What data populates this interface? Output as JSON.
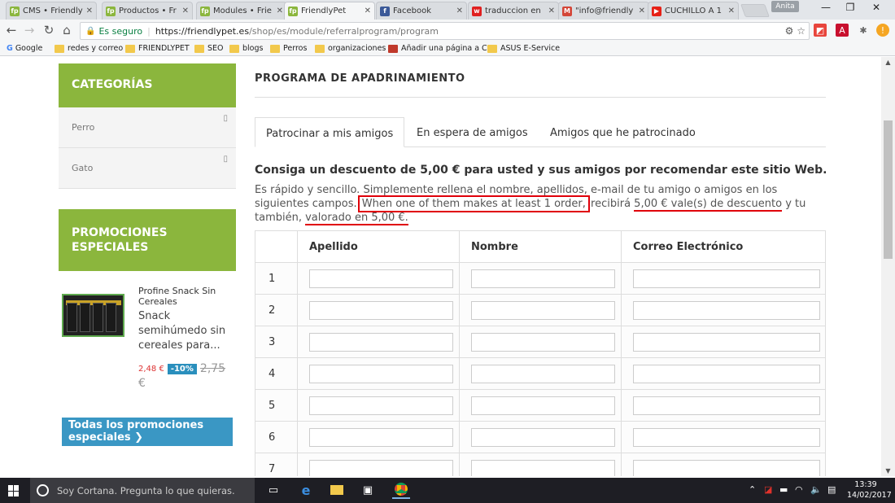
{
  "browser": {
    "tabs": [
      {
        "title": "CMS • Friendly",
        "favicon": "fp",
        "color": "#8bb63d",
        "active": false
      },
      {
        "title": "Productos • Fr",
        "favicon": "fp",
        "color": "#8bb63d",
        "active": false
      },
      {
        "title": "Modules • Frie",
        "favicon": "fp",
        "color": "#8bb63d",
        "active": false
      },
      {
        "title": "FriendlyPet",
        "favicon": "fp",
        "color": "#8bb63d",
        "active": true
      },
      {
        "title": "Facebook",
        "favicon": "f",
        "color": "#3b5998",
        "active": false
      },
      {
        "title": "traduccion en",
        "favicon": "w",
        "color": "#e02020",
        "active": false
      },
      {
        "title": "\"info@friendly",
        "favicon": "M",
        "color": "#d44638",
        "active": false
      },
      {
        "title": "CUCHILLO A 1",
        "favicon": "▶",
        "color": "#e62117",
        "active": false
      }
    ],
    "profile_name": "Anita",
    "secure_label": "Es seguro",
    "url_host": "https://friendlypet.es",
    "url_path": "/shop/es/module/referralprogram/program",
    "bookmarks": [
      {
        "label": "Google",
        "icon": "google-icon"
      },
      {
        "label": "redes y correo",
        "icon": "folder-icon"
      },
      {
        "label": "FRIENDLYPET",
        "icon": "folder-icon"
      },
      {
        "label": "SEO",
        "icon": "folder-icon"
      },
      {
        "label": "blogs",
        "icon": "folder-icon"
      },
      {
        "label": "Perros",
        "icon": "folder-icon"
      },
      {
        "label": "organizaciones",
        "icon": "folder-icon"
      },
      {
        "label": "Añadir una página a C",
        "icon": "page-icon"
      },
      {
        "label": "ASUS E-Service",
        "icon": "folder-icon"
      }
    ]
  },
  "sidebar": {
    "categories_title": "CATEGORÍAS",
    "categories": [
      {
        "label": "Perro"
      },
      {
        "label": "Gato"
      }
    ],
    "promotions_title": "PROMOCIONES ESPECIALES",
    "product": {
      "name": "Profine Snack Sin Cereales",
      "description": "Snack semihúmedo sin cereales para...",
      "price": "2,48 €",
      "discount": "-10%",
      "old_price": "2,75",
      "old_price_currency": "€"
    },
    "all_promotions_label": "Todas los promociones especiales"
  },
  "content": {
    "title": "PROGRAMA DE APADRINAMIENTO",
    "tabs": [
      {
        "label": "Patrocinar a mis amigos",
        "active": true
      },
      {
        "label": "En espera de amigos",
        "active": false
      },
      {
        "label": "Amigos que he patrocinado",
        "active": false
      }
    ],
    "lead": "Consiga un descuento de 5,00 € para usted y sus amigos por recomendar este sitio Web.",
    "desc_part1": "Es rápido y sencillo. Simplemente rellena el nombre, apellidos, e-mail de tu amigo o amigos en los siguientes campos. ",
    "desc_highlight": "When one of them makes at least 1 order,",
    "desc_part2": " recibirá ",
    "desc_underline1": "5,00 € vale(s) de descuento",
    "desc_part3": " y tu también, ",
    "desc_underline2": "valorado en 5,00 €.",
    "table": {
      "headers": [
        "",
        "Apellido",
        "Nombre",
        "Correo Electrónico"
      ],
      "rows": [
        "1",
        "2",
        "3",
        "4",
        "5",
        "6",
        "7"
      ]
    }
  },
  "taskbar": {
    "cortana_placeholder": "Soy Cortana. Pregunta lo que quieras.",
    "time": "13:39",
    "date": "14/02/2017"
  }
}
